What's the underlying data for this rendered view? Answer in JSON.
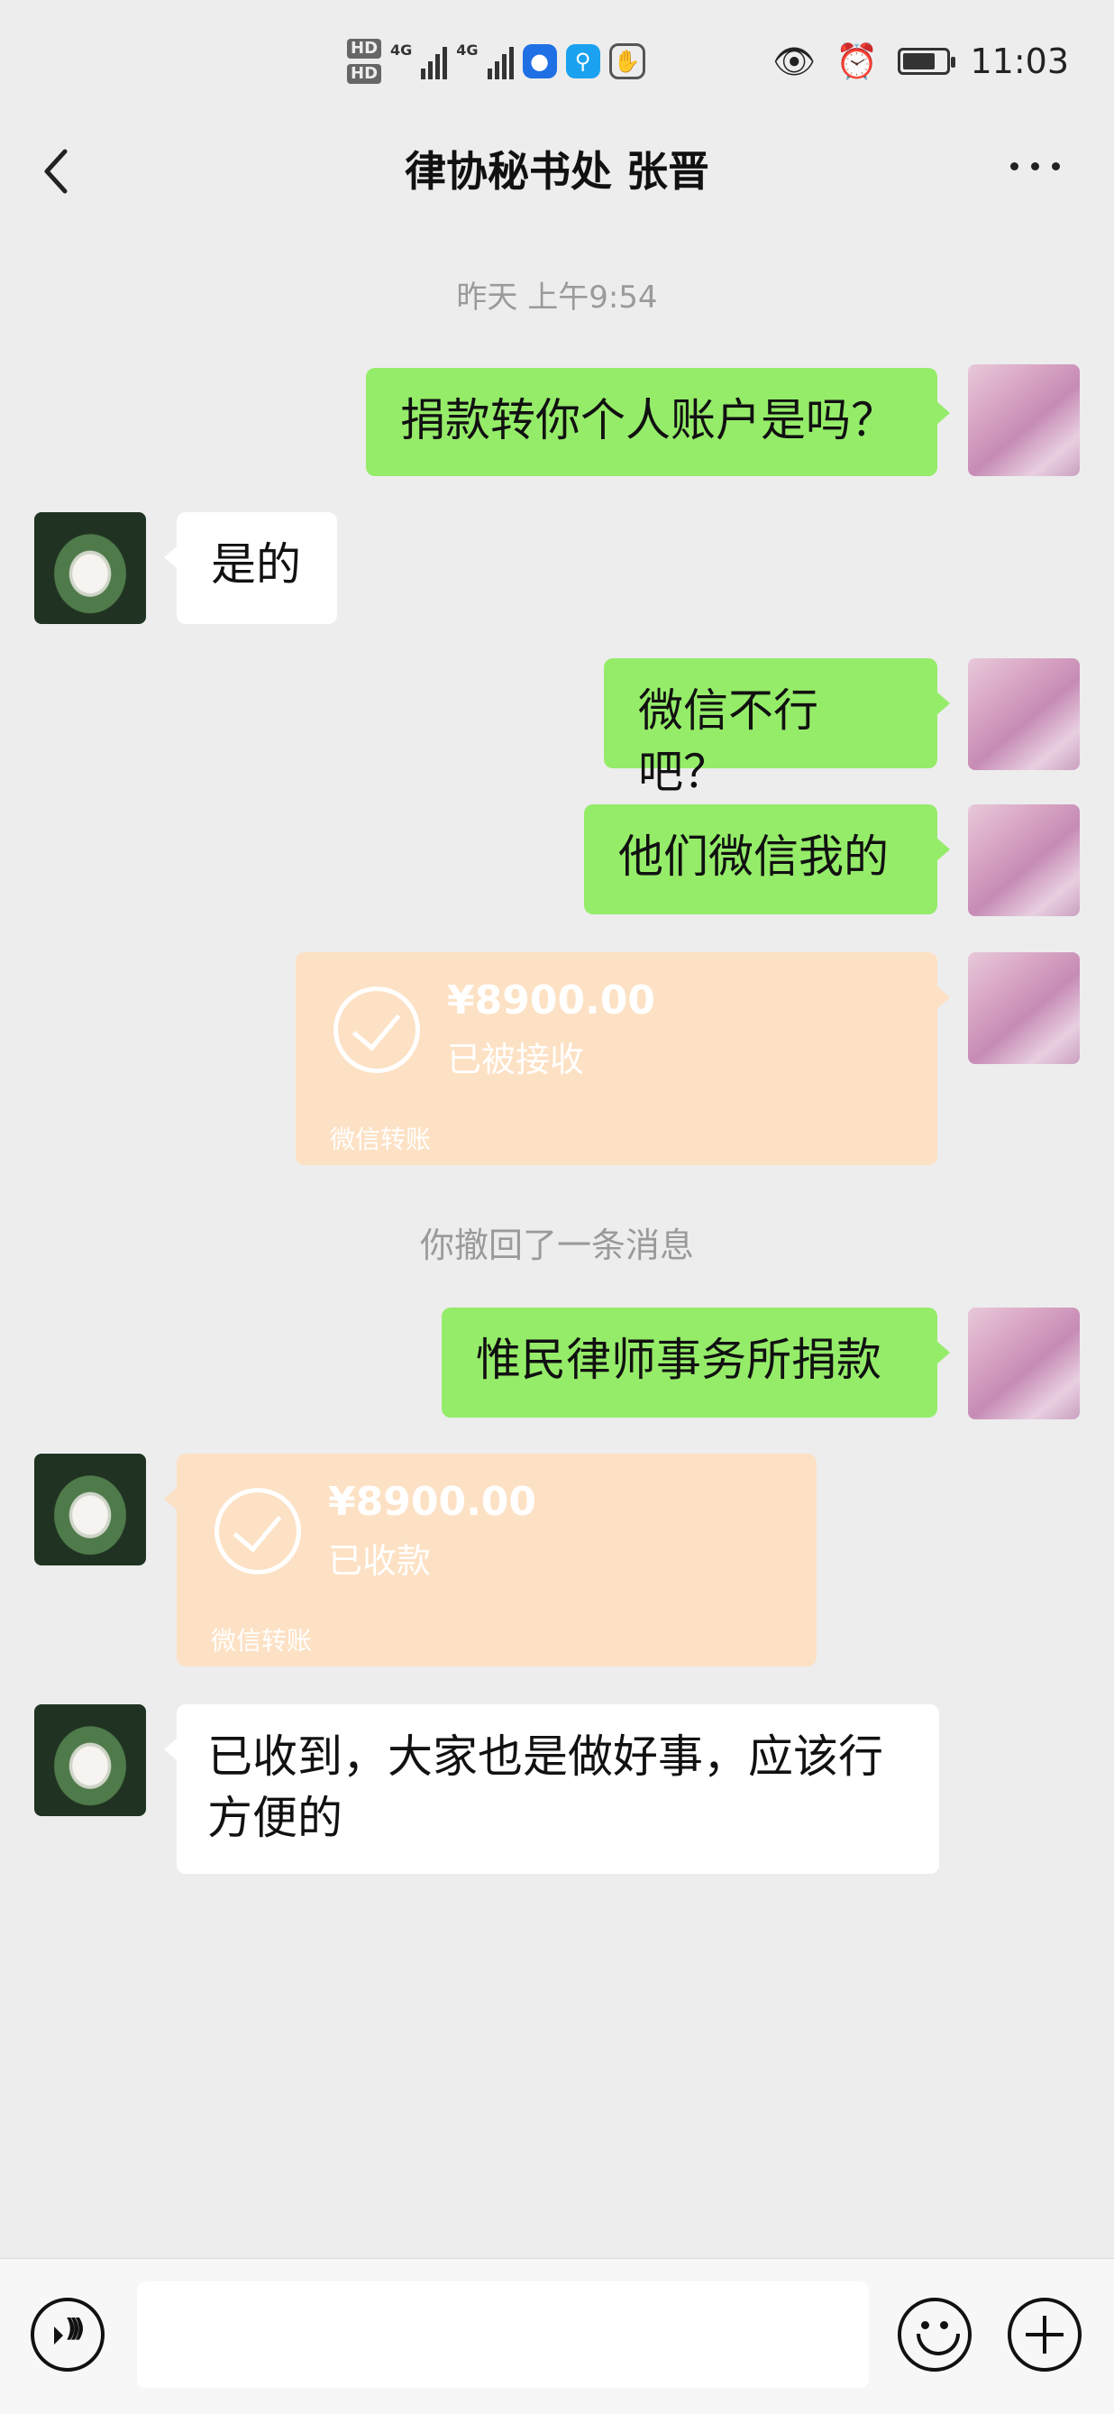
{
  "status_bar": {
    "hd1": "HD",
    "hd2": "HD",
    "net1": "4G",
    "net2": "4G",
    "time": "11:03",
    "battery_level": 0.75,
    "app_icons": [
      "lightbulb-icon",
      "search-app-icon",
      "hand-icon"
    ],
    "right_icons": [
      "eye-icon",
      "alarm-icon",
      "battery-icon"
    ]
  },
  "header": {
    "title": "律协秘书处 张晋",
    "back_icon": "chevron-left-icon",
    "more_icon": "more-dots-icon"
  },
  "timestamp": "昨天 上午9:54",
  "messages": [
    {
      "side": "me",
      "type": "text",
      "text": "捐款转你个人账户是吗？"
    },
    {
      "side": "them",
      "type": "text",
      "text": "是的"
    },
    {
      "side": "me",
      "type": "text",
      "text": "微信不行吧？"
    },
    {
      "side": "me",
      "type": "text",
      "text": "他们微信我的"
    },
    {
      "side": "me",
      "type": "transfer",
      "amount": "¥8900.00",
      "status": "已被接收",
      "source": "微信转账"
    },
    {
      "side": "me",
      "type": "text",
      "text": "惟民律师事务所捐款"
    },
    {
      "side": "them",
      "type": "transfer",
      "amount": "¥8900.00",
      "status": "已收款",
      "source": "微信转账"
    },
    {
      "side": "them",
      "type": "text",
      "text": "已收到，大家也是做好事，应该行方便的"
    }
  ],
  "recall_notice": "你撤回了一条消息",
  "bottom_bar": {
    "voice_icon": "voice-icon",
    "emoji_icon": "emoji-icon",
    "plus_icon": "plus-icon",
    "input_value": ""
  },
  "colors": {
    "background": "#ededed",
    "my_bubble": "#95ec69",
    "their_bubble": "#ffffff",
    "transfer_card": "#fde1c4"
  }
}
